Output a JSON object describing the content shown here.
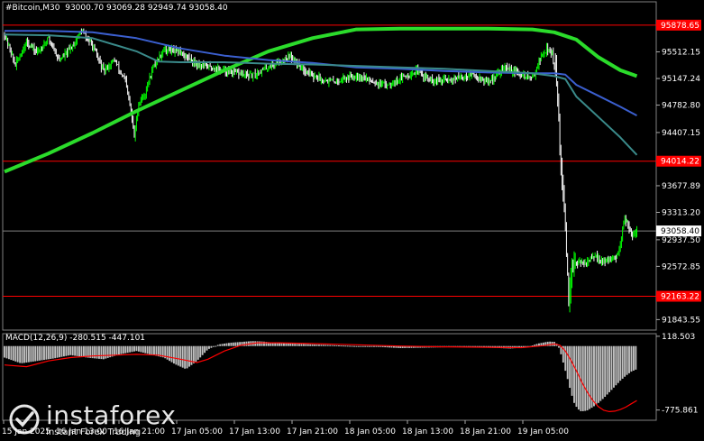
{
  "header": {
    "symbol": "#Bitcoin,M30",
    "ohlc": "93000.70 93069.28 92949.74 93058.40"
  },
  "macd_header": {
    "label": "MACD(12,26,9)",
    "values": "-280.515 -447.101"
  },
  "colors": {
    "background": "#000000",
    "bull": "#00ff00",
    "bear": "#ffffff",
    "ma_fast": "#3a8a8a",
    "ma_mid": "#3b5fcf",
    "ma_slow": "#2bdc2b",
    "level": "#ff0000",
    "macd_hist": "#c0c0c0",
    "macd_signal": "#ff0000"
  },
  "logo": {
    "brand": "instaforex",
    "tagline": "Instant Forex Trading"
  },
  "chart_data": [
    {
      "type": "candlestick",
      "ylim": [
        91700,
        96050
      ],
      "yticks": [
        95512.15,
        95147.24,
        94782.8,
        94407.15,
        93677.89,
        93313.2,
        92937.5,
        92572.85,
        91843.55
      ],
      "xticks": [
        "15 Jan 2025",
        "16 Jan 13:00",
        "16 Jan 21:00",
        "17 Jan 05:00",
        "17 Jan 13:00",
        "17 Jan 21:00",
        "18 Jan 05:00",
        "18 Jan 13:00",
        "18 Jan 21:00",
        "19 Jan 05:00"
      ],
      "levels": [
        {
          "label": "95878.65",
          "value": 95878.65
        },
        {
          "label": "94014.22",
          "value": 94014.22
        },
        {
          "label": "92163.22",
          "value": 92163.22
        }
      ],
      "current_price": {
        "label": "93058.40",
        "value": 93058.4
      },
      "path": [
        [
          0,
          95750
        ],
        [
          10,
          95330
        ],
        [
          20,
          95650
        ],
        [
          30,
          95500
        ],
        [
          40,
          95700
        ],
        [
          50,
          95400
        ],
        [
          60,
          95550
        ],
        [
          70,
          95800
        ],
        [
          80,
          95600
        ],
        [
          90,
          95250
        ],
        [
          100,
          95400
        ],
        [
          110,
          95100
        ],
        [
          115,
          94700
        ],
        [
          118,
          94350
        ],
        [
          122,
          94800
        ],
        [
          128,
          94950
        ],
        [
          135,
          95300
        ],
        [
          145,
          95550
        ],
        [
          160,
          95500
        ],
        [
          175,
          95350
        ],
        [
          200,
          95250
        ],
        [
          225,
          95180
        ],
        [
          245,
          95350
        ],
        [
          260,
          95450
        ],
        [
          270,
          95300
        ],
        [
          285,
          95150
        ],
        [
          300,
          95100
        ],
        [
          320,
          95200
        ],
        [
          345,
          95050
        ],
        [
          360,
          95150
        ],
        [
          375,
          95250
        ],
        [
          390,
          95100
        ],
        [
          410,
          95150
        ],
        [
          425,
          95200
        ],
        [
          440,
          95100
        ],
        [
          455,
          95300
        ],
        [
          470,
          95200
        ],
        [
          480,
          95150
        ],
        [
          488,
          95450
        ],
        [
          493,
          95550
        ],
        [
          498,
          95500
        ],
        [
          501,
          95200
        ],
        [
          503,
          94800
        ],
        [
          505,
          94200
        ],
        [
          507,
          93700
        ],
        [
          509,
          93300
        ],
        [
          511,
          92700
        ],
        [
          513,
          92050
        ],
        [
          515,
          92300
        ],
        [
          518,
          92700
        ],
        [
          522,
          92600
        ],
        [
          530,
          92650
        ],
        [
          538,
          92700
        ],
        [
          546,
          92620
        ],
        [
          552,
          92700
        ],
        [
          556,
          92650
        ],
        [
          560,
          92900
        ],
        [
          564,
          93250
        ],
        [
          567,
          93150
        ],
        [
          571,
          93000
        ],
        [
          575,
          93058
        ]
      ],
      "seed": 42
    },
    {
      "type": "line",
      "subtype": "moving_averages",
      "series": [
        {
          "color": "#2bdc2b",
          "x": [
            0,
            40,
            80,
            120,
            160,
            200,
            240,
            280,
            320,
            360,
            400,
            440,
            480,
            500,
            520,
            540,
            560,
            575
          ],
          "y": [
            93870,
            94120,
            94400,
            94700,
            94980,
            95260,
            95520,
            95700,
            95820,
            95830,
            95830,
            95830,
            95820,
            95780,
            95680,
            95440,
            95260,
            95180
          ]
        },
        {
          "color": "#3b5fcf",
          "x": [
            0,
            40,
            80,
            120,
            160,
            200,
            240,
            280,
            320,
            360,
            400,
            440,
            480,
            500,
            510,
            520,
            540,
            560,
            575
          ],
          "y": [
            95800,
            95800,
            95780,
            95700,
            95560,
            95460,
            95400,
            95360,
            95300,
            95280,
            95250,
            95230,
            95220,
            95220,
            95200,
            95060,
            94910,
            94760,
            94640
          ]
        },
        {
          "color": "#3a8a8a",
          "x": [
            0,
            40,
            80,
            120,
            140,
            160,
            200,
            240,
            280,
            320,
            360,
            400,
            440,
            480,
            500,
            510,
            520,
            540,
            560,
            575
          ],
          "y": [
            95750,
            95740,
            95700,
            95520,
            95380,
            95370,
            95370,
            95350,
            95340,
            95320,
            95300,
            95280,
            95250,
            95220,
            95180,
            95140,
            94900,
            94620,
            94340,
            94100
          ]
        }
      ]
    },
    {
      "type": "bar",
      "subtype": "macd_histogram",
      "ylim": [
        -900,
        150
      ],
      "yticks": [
        118.503,
        -775.861
      ],
      "macd_hist": [
        [
          0,
          -140
        ],
        [
          15,
          -210
        ],
        [
          30,
          -180
        ],
        [
          45,
          -150
        ],
        [
          60,
          -110
        ],
        [
          75,
          -140
        ],
        [
          90,
          -160
        ],
        [
          105,
          -100
        ],
        [
          120,
          -60
        ],
        [
          135,
          -110
        ],
        [
          145,
          -140
        ],
        [
          155,
          -220
        ],
        [
          165,
          -280
        ],
        [
          175,
          -180
        ],
        [
          185,
          -40
        ],
        [
          195,
          20
        ],
        [
          205,
          40
        ],
        [
          215,
          50
        ],
        [
          225,
          60
        ],
        [
          235,
          55
        ],
        [
          245,
          40
        ],
        [
          260,
          30
        ],
        [
          280,
          20
        ],
        [
          300,
          10
        ],
        [
          320,
          0
        ],
        [
          340,
          -10
        ],
        [
          360,
          -25
        ],
        [
          380,
          -20
        ],
        [
          400,
          -15
        ],
        [
          420,
          -10
        ],
        [
          440,
          -20
        ],
        [
          460,
          -30
        ],
        [
          475,
          -15
        ],
        [
          485,
          30
        ],
        [
          495,
          55
        ],
        [
          500,
          50
        ],
        [
          503,
          20
        ],
        [
          506,
          -100
        ],
        [
          509,
          -250
        ],
        [
          512,
          -400
        ],
        [
          515,
          -560
        ],
        [
          518,
          -690
        ],
        [
          521,
          -760
        ],
        [
          524,
          -790
        ],
        [
          527,
          -790
        ],
        [
          530,
          -780
        ],
        [
          535,
          -740
        ],
        [
          540,
          -690
        ],
        [
          545,
          -630
        ],
        [
          550,
          -560
        ],
        [
          555,
          -490
        ],
        [
          560,
          -420
        ],
        [
          565,
          -360
        ],
        [
          570,
          -310
        ],
        [
          575,
          -280
        ]
      ],
      "macd_signal": [
        [
          0,
          -230
        ],
        [
          20,
          -250
        ],
        [
          40,
          -180
        ],
        [
          60,
          -140
        ],
        [
          80,
          -120
        ],
        [
          100,
          -110
        ],
        [
          120,
          -100
        ],
        [
          140,
          -110
        ],
        [
          160,
          -160
        ],
        [
          175,
          -200
        ],
        [
          185,
          -160
        ],
        [
          200,
          -60
        ],
        [
          215,
          10
        ],
        [
          230,
          40
        ],
        [
          250,
          40
        ],
        [
          280,
          30
        ],
        [
          320,
          15
        ],
        [
          360,
          0
        ],
        [
          400,
          -10
        ],
        [
          440,
          -15
        ],
        [
          470,
          -20
        ],
        [
          490,
          5
        ],
        [
          500,
          25
        ],
        [
          505,
          10
        ],
        [
          510,
          -60
        ],
        [
          515,
          -170
        ],
        [
          520,
          -300
        ],
        [
          525,
          -440
        ],
        [
          530,
          -560
        ],
        [
          535,
          -660
        ],
        [
          540,
          -735
        ],
        [
          545,
          -780
        ],
        [
          550,
          -795
        ],
        [
          555,
          -790
        ],
        [
          560,
          -770
        ],
        [
          565,
          -740
        ],
        [
          570,
          -700
        ],
        [
          575,
          -660
        ]
      ]
    }
  ]
}
